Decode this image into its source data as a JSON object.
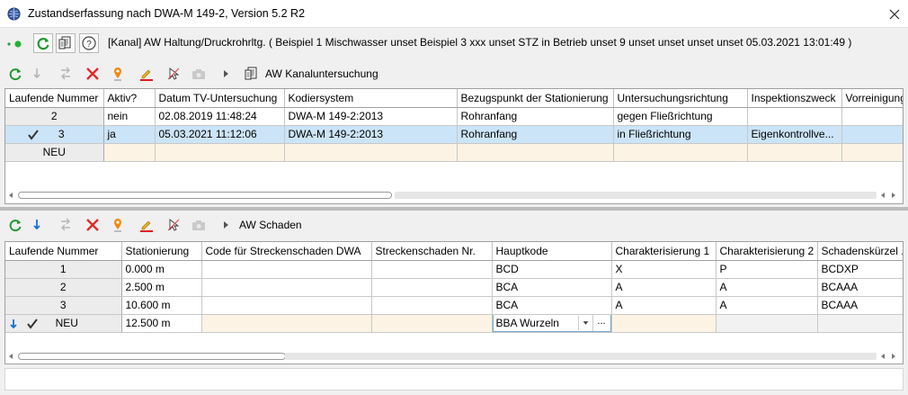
{
  "window": {
    "title": "Zustandserfassung nach DWA-M 149-2, Version 5.2 R2"
  },
  "info": {
    "text": "[Kanal] AW Haltung/Druckrohrltg. ( Beispiel 1 Mischwasser unset Beispiel 3 xxx unset STZ in Betrieb unset 9 unset unset unset unset 05.03.2021 13:01:49 )"
  },
  "upper_toolbar": {
    "label": "AW Kanaluntersuchung"
  },
  "upper_table": {
    "columns": [
      "Laufende Nummer",
      "Aktiv?",
      "Datum TV-Untersuchung",
      "Kodiersystem",
      "Bezugspunkt der Stationierung",
      "Untersuchungsrichtung",
      "Inspektionszweck",
      "Vorreinigung"
    ],
    "rows": [
      [
        "2",
        "nein",
        "02.08.2019 11:48:24",
        "DWA-M 149-2:2013",
        "Rohranfang",
        "gegen Fließrichtung",
        "",
        ""
      ],
      [
        "3",
        "ja",
        "05.03.2021 11:12:06",
        "DWA-M 149-2:2013",
        "Rohranfang",
        "in Fließrichtung",
        "Eigenkontrollve...",
        ""
      ]
    ],
    "new_row_label": "NEU"
  },
  "lower_toolbar": {
    "label": "AW Schaden"
  },
  "lower_table": {
    "columns": [
      "Laufende Nummer",
      "Stationierung",
      "Code für Streckenschaden DWA",
      "Streckenschaden Nr.",
      "Hauptkode",
      "Charakterisierung 1",
      "Charakterisierung 2",
      "Schadenskürzel ..."
    ],
    "rows": [
      [
        "1",
        "0.000 m",
        "",
        "",
        "BCD",
        "X",
        "P",
        "BCDXP"
      ],
      [
        "2",
        "2.500 m",
        "",
        "",
        "BCA",
        "A",
        "A",
        "BCAAA"
      ],
      [
        "3",
        "10.600 m",
        "",
        "",
        "BCA",
        "A",
        "A",
        "BCAAA"
      ]
    ],
    "new_row": {
      "label": "NEU",
      "stationierung": "12.500 m",
      "hauptkode": "BBA Wurzeln",
      "more_button": "..."
    }
  }
}
